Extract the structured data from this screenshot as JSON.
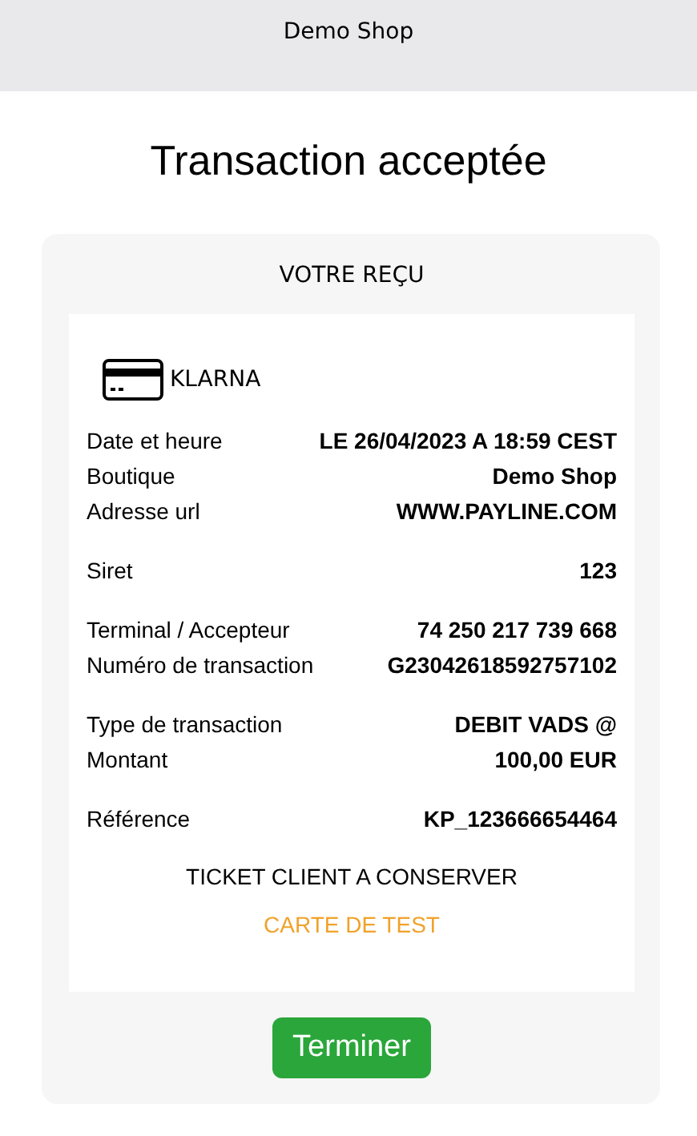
{
  "header": {
    "title": "Demo Shop"
  },
  "title": "Transaction acceptée",
  "receipt": {
    "heading": "VOTRE REÇU",
    "payment_method": "KLARNA",
    "sections": [
      [
        {
          "label": "Date et heure",
          "value": "LE 26/04/2023 A 18:59 CEST"
        },
        {
          "label": "Boutique",
          "value": "Demo Shop"
        },
        {
          "label": "Adresse url",
          "value": "WWW.PAYLINE.COM"
        }
      ],
      [
        {
          "label": "Siret",
          "value": "123"
        }
      ],
      [
        {
          "label": "Terminal / Accepteur",
          "value": "74 250 217 739 668"
        },
        {
          "label": "Numéro de transaction",
          "value": "G23042618592757102"
        }
      ],
      [
        {
          "label": "Type de transaction",
          "value": "DEBIT VADS @"
        },
        {
          "label": "Montant",
          "value": "100,00 EUR"
        }
      ],
      [
        {
          "label": "Référence",
          "value": "KP_123666654464"
        }
      ]
    ],
    "notice": "TICKET CLIENT A CONSERVER",
    "test_notice": "CARTE DE TEST"
  },
  "button": "Terminer"
}
